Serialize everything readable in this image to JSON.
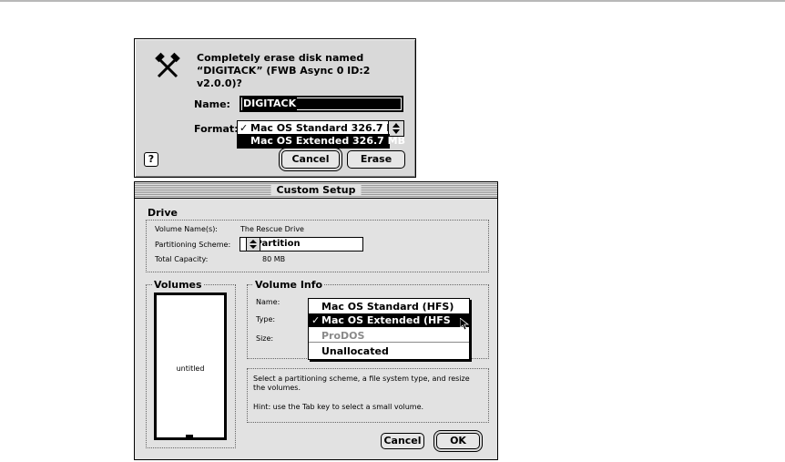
{
  "erase_dialog": {
    "message_line1": "Completely erase disk named",
    "message_line2": "“DIGITACK” (FWB Async 0 ID:2 v2.0.0)?",
    "name_label": "Name:",
    "name_value": "DIGITACK",
    "format_label": "Format:",
    "format_check": "✓",
    "format_options": [
      "Mac OS Standard 326.7 MB",
      "Mac OS Extended 326.7 MB"
    ],
    "help_glyph": "?",
    "cancel_label": "Cancel",
    "erase_label": "Erase"
  },
  "custom_setup": {
    "title": "Custom Setup",
    "drive_header": "Drive",
    "volume_names_label": "Volume Name(s):",
    "volume_names_value": "The Rescue Drive",
    "partitioning_label": "Partitioning Scheme:",
    "partitioning_value": "1 Partition",
    "capacity_label": "Total Capacity:",
    "capacity_value": "80  MB",
    "volumes_header": "Volumes",
    "volume_label": "untitled",
    "volume_info_header": "Volume Info",
    "name_label": "Name:",
    "type_label": "Type:",
    "size_label": "Size:",
    "type_menu": {
      "items": [
        "Mac OS Standard (HFS)",
        "Mac OS Extended (HFS Plus)",
        "ProDOS",
        "Unallocated"
      ],
      "selected": "Mac OS Extended (HFS Plus)",
      "check": "✓"
    },
    "help_text": "Select a partitioning scheme, a file system type, and resize the volumes.",
    "hint_text": "Hint: use the Tab key to select a small volume.",
    "cancel_label": "Cancel",
    "ok_label": "OK"
  }
}
